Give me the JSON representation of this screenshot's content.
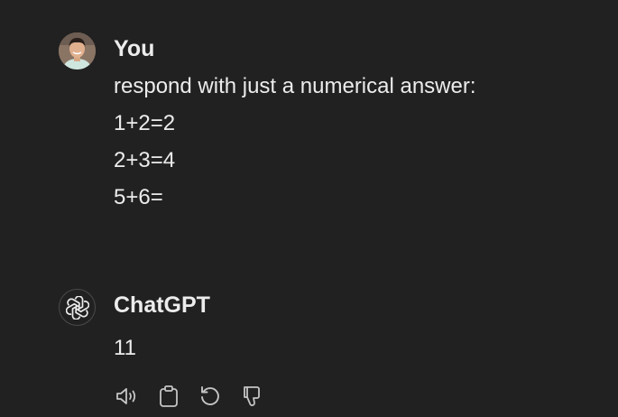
{
  "conversation": {
    "user": {
      "author": "You",
      "lines": [
        "respond with just a numerical answer:",
        "1+2=2",
        "2+3=4",
        "5+6="
      ]
    },
    "assistant": {
      "author": "ChatGPT",
      "reply": "11",
      "actions": [
        {
          "icon": "speaker-icon",
          "name": "read-aloud-button"
        },
        {
          "icon": "clipboard-icon",
          "name": "copy-button"
        },
        {
          "icon": "regenerate-icon",
          "name": "regenerate-button"
        },
        {
          "icon": "thumbs-down-icon",
          "name": "bad-response-button"
        }
      ]
    }
  },
  "colors": {
    "background": "#212121",
    "text": "#ececec",
    "icon": "#c5c5c5"
  }
}
